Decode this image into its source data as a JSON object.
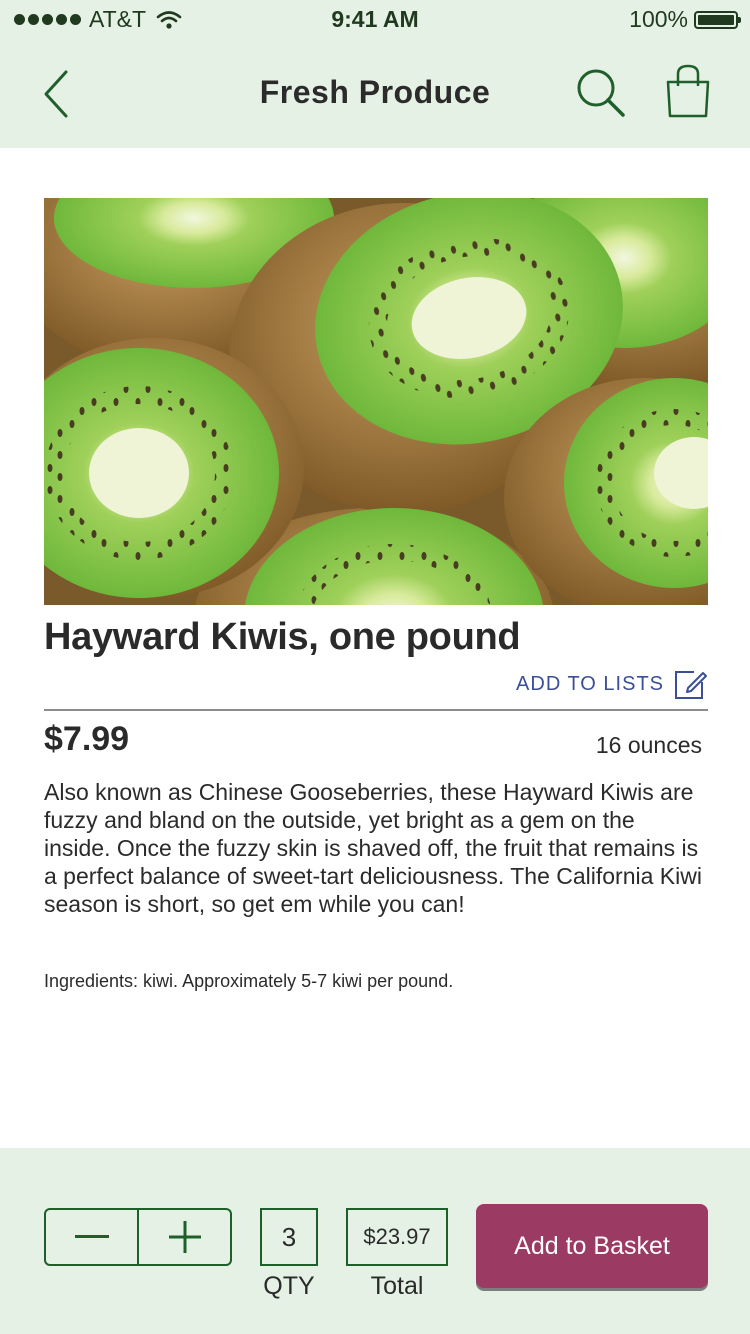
{
  "status_bar": {
    "carrier": "AT&T",
    "time": "9:41 AM",
    "battery": "100%"
  },
  "header": {
    "title": "Fresh Produce",
    "back_icon": "chevron-left-icon",
    "search_icon": "search-icon",
    "basket_icon": "shopping-bag-icon"
  },
  "product": {
    "title": "Hayward Kiwis, one pound",
    "add_to_lists": "ADD TO LISTS",
    "price": "$7.99",
    "weight": "16 ounces",
    "description": "Also known as Chinese Gooseberries, these Hayward Kiwis are fuzzy and bland on the outside, yet bright as a gem on the inside. Once the fuzzy skin is shaved off, the fruit that remains is a perfect balance of sweet-tart deliciousness. The California Kiwi season is short, so get em while you can!",
    "ingredients": "Ingredients: kiwi. Approximately 5-7 kiwi per pound."
  },
  "cart": {
    "quantity": "3",
    "qty_label": "QTY",
    "total": "$23.97",
    "total_label": "Total",
    "add_button": "Add to Basket"
  },
  "colors": {
    "header_bg": "#e6f1e6",
    "accent_green": "#1f5f2a",
    "link_blue": "#3a4f98",
    "button_maroon": "#9b3a63"
  }
}
